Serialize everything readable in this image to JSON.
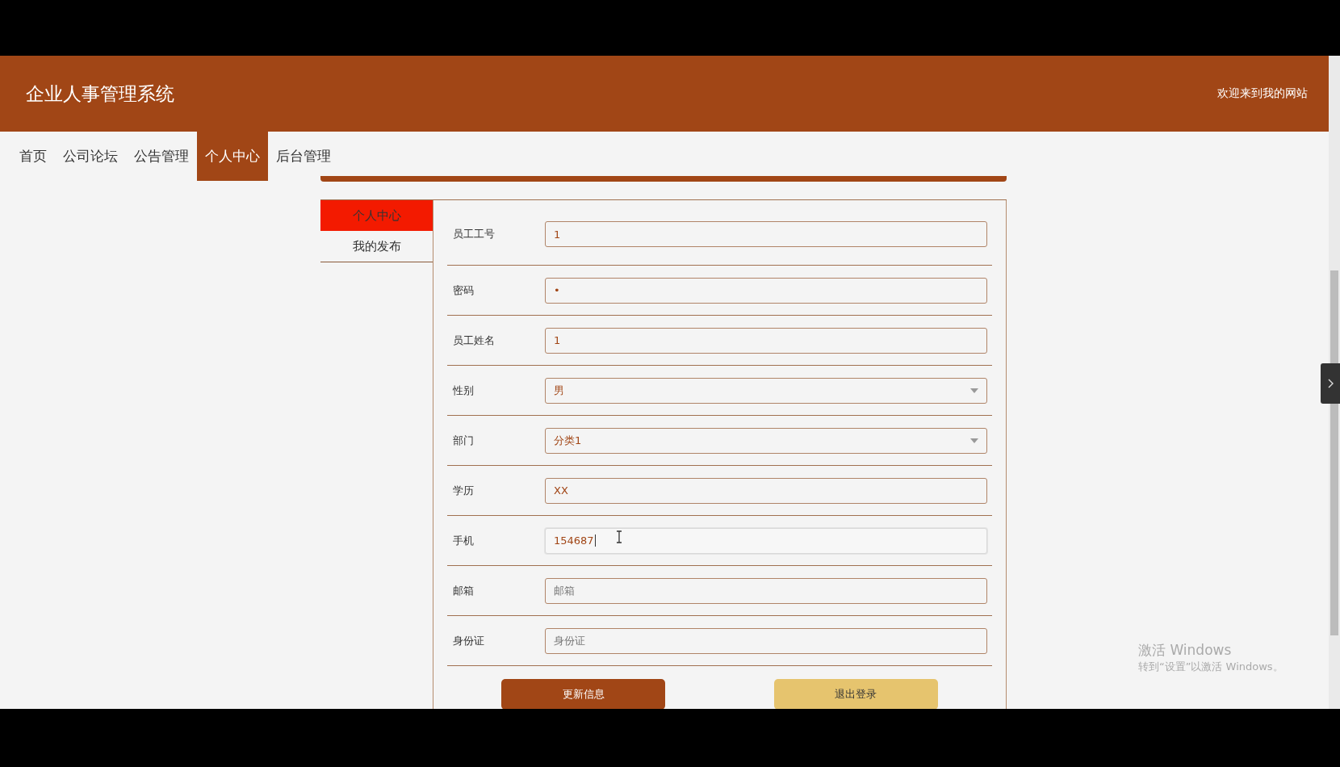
{
  "header": {
    "title": "企业人事管理系统",
    "welcome": "欢迎来到我的网站"
  },
  "nav": [
    {
      "label": "首页",
      "selected": false
    },
    {
      "label": "公司论坛",
      "selected": false
    },
    {
      "label": "公告管理",
      "selected": false
    },
    {
      "label": "个人中心",
      "selected": true
    },
    {
      "label": "后台管理",
      "selected": false
    }
  ],
  "sidebar": {
    "items": [
      {
        "label": "个人中心",
        "selected": true
      },
      {
        "label": "我的发布",
        "selected": false
      }
    ]
  },
  "form": {
    "fields": [
      {
        "label": "员工工号",
        "kind": "text",
        "value": "1",
        "focused": false
      },
      {
        "label": "密码",
        "kind": "text",
        "value": "•",
        "focused": false
      },
      {
        "label": "员工姓名",
        "kind": "text",
        "value": "1",
        "focused": false
      },
      {
        "label": "性别",
        "kind": "select",
        "value": "男",
        "focused": false
      },
      {
        "label": "部门",
        "kind": "select",
        "value": "分类1",
        "focused": false
      },
      {
        "label": "学历",
        "kind": "text",
        "value": "XX",
        "focused": false
      },
      {
        "label": "手机",
        "kind": "text",
        "value": "154687",
        "focused": true
      },
      {
        "label": "邮箱",
        "kind": "text",
        "placeholder": "邮箱",
        "focused": false
      },
      {
        "label": "身份证",
        "kind": "text",
        "placeholder": "身份证",
        "focused": false
      }
    ],
    "buttons": [
      {
        "label": "更新信息",
        "kind": "primary"
      },
      {
        "label": "退出登录",
        "kind": "secondary"
      }
    ]
  },
  "activation_notice": {
    "title": "激活 Windows",
    "subtitle": "转到“设置”以激活 Windows。"
  }
}
